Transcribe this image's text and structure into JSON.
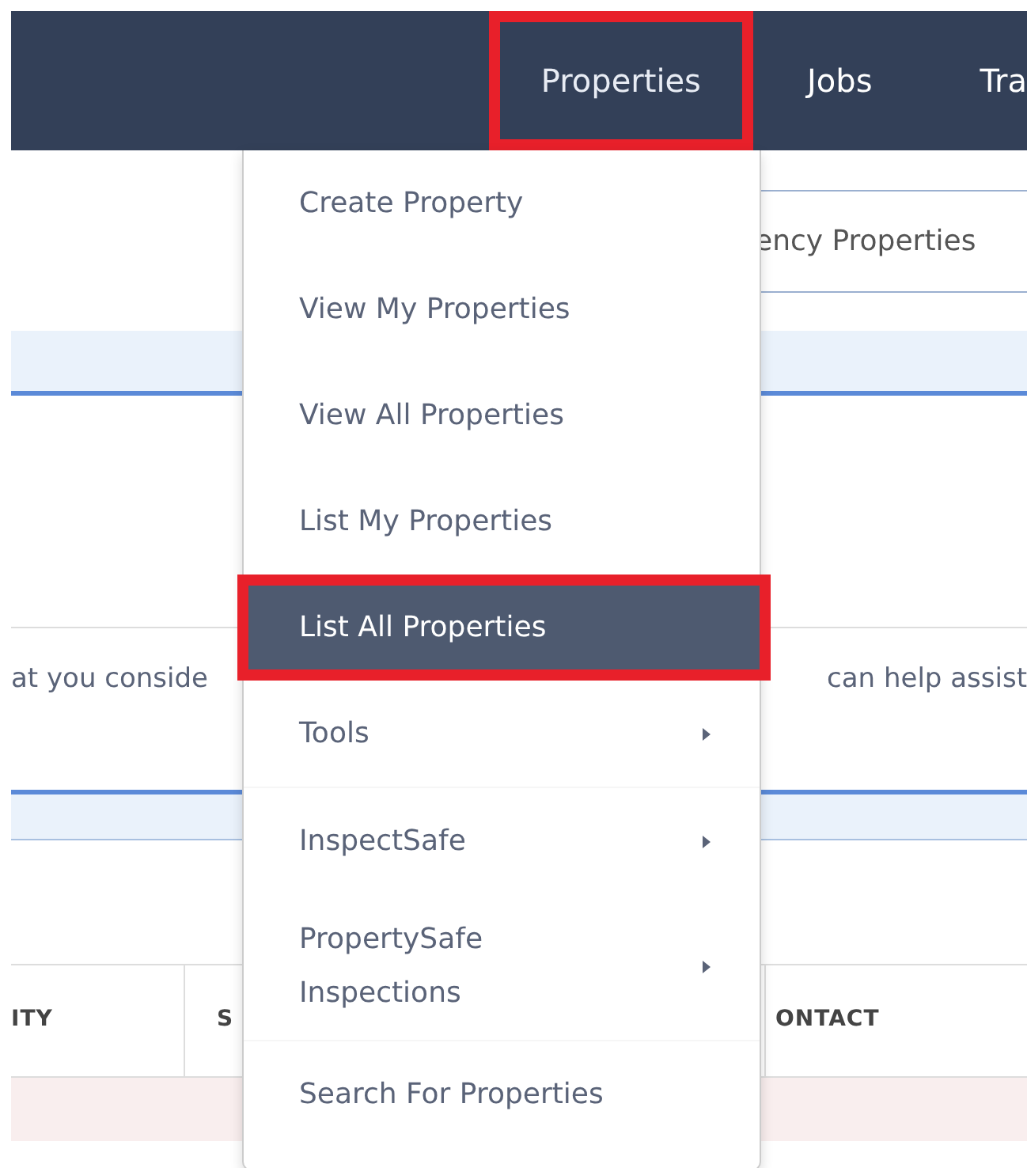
{
  "navbar": {
    "items": [
      {
        "label": "Properties",
        "selected": true,
        "highlighted": true
      },
      {
        "label": "Jobs",
        "selected": false,
        "highlighted": false
      },
      {
        "label": "Tra",
        "selected": false,
        "highlighted": false
      }
    ]
  },
  "background": {
    "filter_field": {
      "value": "ency Properties"
    },
    "notice_left": "at you conside",
    "notice_right": "can help assist",
    "table_columns": [
      "ITY",
      "S",
      "ONTACT"
    ]
  },
  "dropdown": {
    "items": [
      {
        "kind": "item",
        "label": "Create Property",
        "selected": false,
        "highlighted": false,
        "submenu": false
      },
      {
        "kind": "item",
        "label": "View My Properties",
        "selected": false,
        "highlighted": false,
        "submenu": false
      },
      {
        "kind": "item",
        "label": "View All Properties",
        "selected": false,
        "highlighted": false,
        "submenu": false
      },
      {
        "kind": "item",
        "label": "List My Properties",
        "selected": false,
        "highlighted": false,
        "submenu": false
      },
      {
        "kind": "item",
        "label": "List All Properties",
        "selected": true,
        "highlighted": true,
        "submenu": false
      },
      {
        "kind": "item",
        "label": "Tools",
        "selected": false,
        "highlighted": false,
        "submenu": true
      },
      {
        "kind": "divider"
      },
      {
        "kind": "item",
        "label": "InspectSafe",
        "selected": false,
        "highlighted": false,
        "submenu": true
      },
      {
        "kind": "item",
        "label": "PropertySafe Inspections",
        "selected": false,
        "highlighted": false,
        "submenu": true
      },
      {
        "kind": "divider"
      },
      {
        "kind": "item",
        "label": "Search For Properties",
        "selected": false,
        "highlighted": false,
        "submenu": false
      }
    ]
  }
}
